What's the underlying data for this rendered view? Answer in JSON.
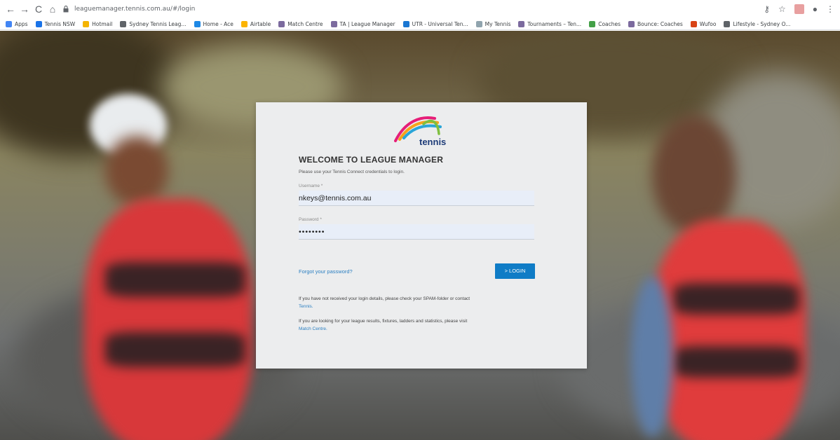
{
  "browser": {
    "url": "leaguemanager.tennis.com.au/#/login",
    "bookmarks": [
      {
        "label": "Apps",
        "color": "#4285f4"
      },
      {
        "label": "Tennis NSW",
        "color": "#1a73e8"
      },
      {
        "label": "Hotmail",
        "color": "#f4b400"
      },
      {
        "label": "Sydney Tennis Leag...",
        "color": "#5f6368"
      },
      {
        "label": "Home - Ace",
        "color": "#1e88e5"
      },
      {
        "label": "Airtable",
        "color": "#fcb400"
      },
      {
        "label": "Match Centre",
        "color": "#7b6a9e"
      },
      {
        "label": "TA | League Manager",
        "color": "#7b6a9e"
      },
      {
        "label": "UTR - Universal Ten...",
        "color": "#1976d2"
      },
      {
        "label": "My Tennis",
        "color": "#90a4ae"
      },
      {
        "label": "Tournaments – Ten...",
        "color": "#7b6a9e"
      },
      {
        "label": "Coaches",
        "color": "#43a047"
      },
      {
        "label": "Bounce: Coaches",
        "color": "#7b6a9e"
      },
      {
        "label": "Wufoo",
        "color": "#d84315"
      },
      {
        "label": "Lifestyle - Sydney O...",
        "color": "#5f6368"
      }
    ]
  },
  "login": {
    "logo_text": "tennis",
    "heading": "WELCOME TO LEAGUE MANAGER",
    "subheading": "Please use your Tennis Connect credentials to login.",
    "username_label": "Username *",
    "username_value": "nkeys@tennis.com.au",
    "password_label": "Password *",
    "password_value": "••••••••",
    "forgot_label": "Forgot your password?",
    "login_label": ">  LOGIN",
    "info1_text": "If you have not received your login details, please check your SPAM-folder or contact",
    "info1_link": "Tennis.",
    "info2_text": "If you are looking for your league results, fixtures, ladders and statistics, please visit",
    "info2_link": "Match Centre."
  },
  "colors": {
    "accent": "#0f7cc6",
    "link": "#2b7fc1",
    "card": "#ecedee"
  }
}
